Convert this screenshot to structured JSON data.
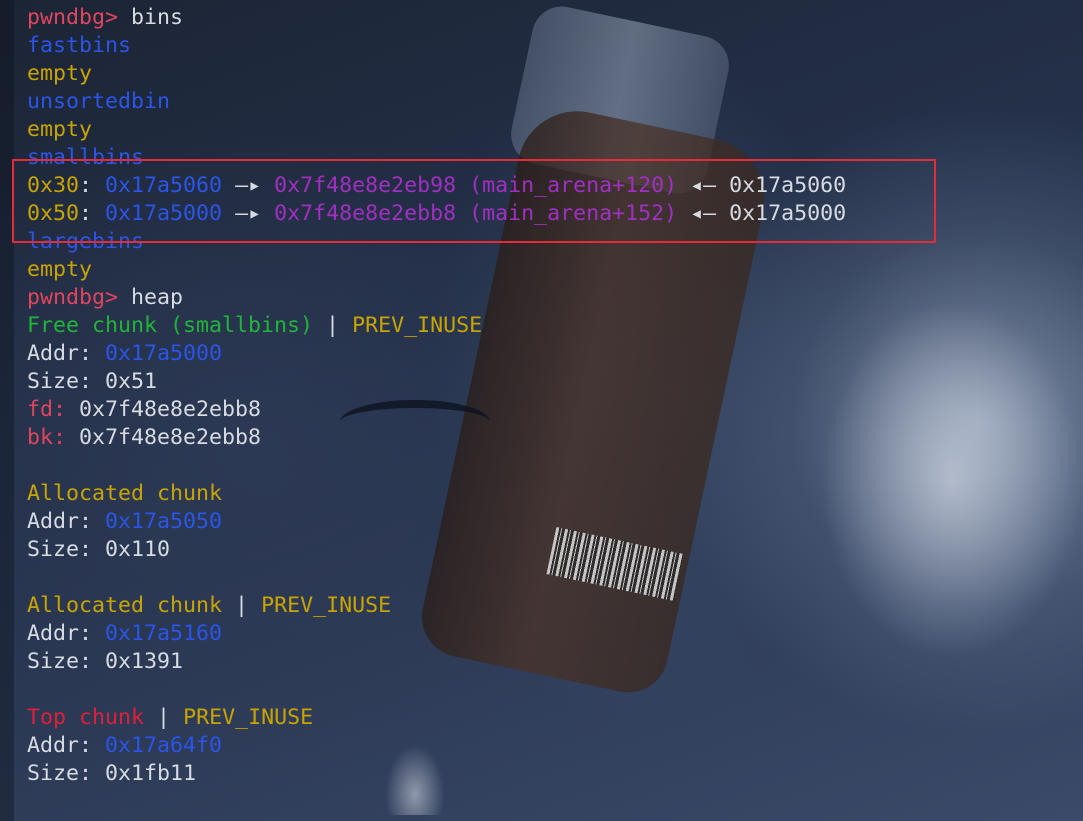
{
  "terminal": {
    "prompt": "pwndbg>",
    "bins_command": "bins",
    "heap_command": "heap",
    "fastbins_label": "fastbins",
    "empty": "empty",
    "unsortedbin_label": "unsortedbin",
    "smallbins_label": "smallbins",
    "largebins_label": "largebins",
    "smallbins_entries": [
      {
        "size": "0x30",
        "chunk": "0x17a5060",
        "arrow": "—▸",
        "target": "0x7f48e8e2eb98 (main_arena+120)",
        "back_arrow": "◂—",
        "back": "0x17a5060"
      },
      {
        "size": "0x50",
        "chunk": "0x17a5000",
        "arrow": "—▸",
        "target": "0x7f48e8e2ebb8 (main_arena+152)",
        "back_arrow": "◂—",
        "back": "0x17a5000"
      }
    ],
    "free_chunk": {
      "title": "Free chunk (smallbins)",
      "separator": "|",
      "flag": "PREV_INUSE",
      "addr_label": "Addr:",
      "addr": "0x17a5000",
      "size_label": "Size:",
      "size": "0x51",
      "fd_label": "fd:",
      "fd": "0x7f48e8e2ebb8",
      "bk_label": "bk:",
      "bk": "0x7f48e8e2ebb8"
    },
    "alloc_chunk_1": {
      "title": "Allocated chunk",
      "addr_label": "Addr:",
      "addr": "0x17a5050",
      "size_label": "Size:",
      "size": "0x110"
    },
    "alloc_chunk_2": {
      "title": "Allocated chunk",
      "separator": "|",
      "flag": "PREV_INUSE",
      "addr_label": "Addr:",
      "addr": "0x17a5160",
      "size_label": "Size:",
      "size": "0x1391"
    },
    "top_chunk": {
      "title": "Top chunk",
      "separator": "|",
      "flag": "PREV_INUSE",
      "addr_label": "Addr:",
      "addr": "0x17a64f0",
      "size_label": "Size:",
      "size": "0x1fb11"
    }
  },
  "colors": {
    "prompt": "#e0455e",
    "address": "#2a55e8",
    "label_yellow": "#c9a400",
    "libc_magenta": "#a12fc2",
    "free_green": "#20b53a",
    "top_red": "#e0203b",
    "highlight_box": "#e52b38"
  }
}
